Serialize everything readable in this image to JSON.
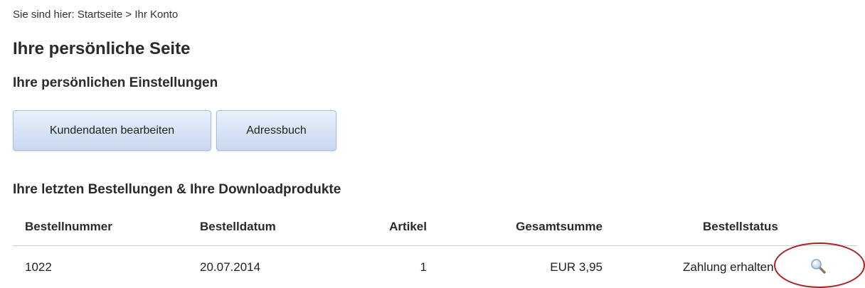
{
  "breadcrumb": "Sie sind hier: Startseite > Ihr Konto",
  "page_title": "Ihre persönliche Seite",
  "settings": {
    "title": "Ihre persönlichen Einstellungen",
    "buttons": [
      "Kundendaten bearbeiten",
      "Adressbuch"
    ]
  },
  "orders": {
    "title": "Ihre letzten Bestellungen & Ihre Downloadprodukte",
    "headers": {
      "nr": "Bestellnummer",
      "datum": "Bestelldatum",
      "artikel": "Artikel",
      "summe": "Gesamtsumme",
      "status": "Bestellstatus"
    },
    "rows": [
      {
        "nr": "1022",
        "datum": "20.07.2014",
        "artikel": "1",
        "summe": "EUR 3,95",
        "status": "Zahlung erhalten"
      }
    ]
  },
  "icons": {
    "details": "magnifier-icon"
  },
  "colors": {
    "annotation_ring": "#b01f1f",
    "button_top": "#e9f0fb",
    "button_bottom": "#c8d8f1"
  }
}
